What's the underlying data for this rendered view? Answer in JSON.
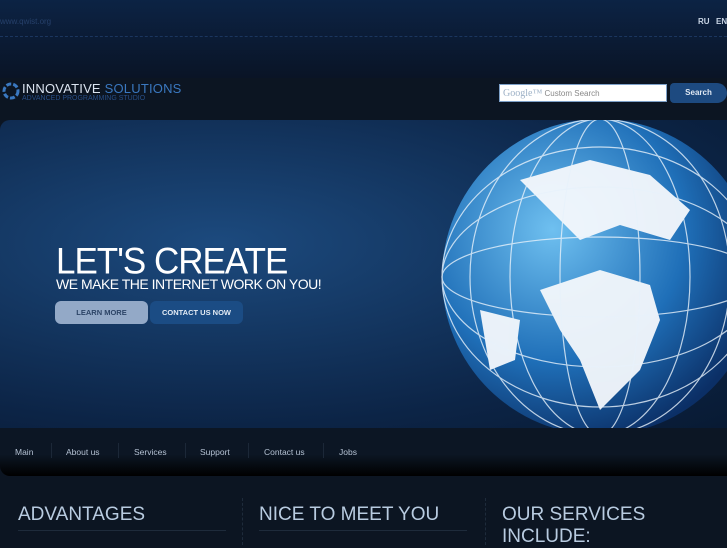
{
  "header": {
    "domain": "www.qwist.org",
    "languages": [
      "RU",
      "EN"
    ]
  },
  "logo": {
    "title_part1": "INNOVATIVE",
    "title_part2": "SOLUTIONS",
    "subtitle": "ADVANCED PROGRAMMING STUDIO"
  },
  "search": {
    "brand": "Google™",
    "placeholder": "Custom Search",
    "button": "Search"
  },
  "hero": {
    "title": "LET'S CREATE",
    "subtitle": "WE MAKE THE INTERNET WORK ON YOU!",
    "learn_more": "LEARN MORE",
    "contact": "CONTACT US NOW"
  },
  "nav": [
    "Main",
    "About us",
    "Services",
    "Support",
    "Contact us",
    "Jobs"
  ],
  "columns": [
    "ADVANTAGES",
    "NICE TO MEET YOU",
    "OUR SERVICES INCLUDE:"
  ]
}
